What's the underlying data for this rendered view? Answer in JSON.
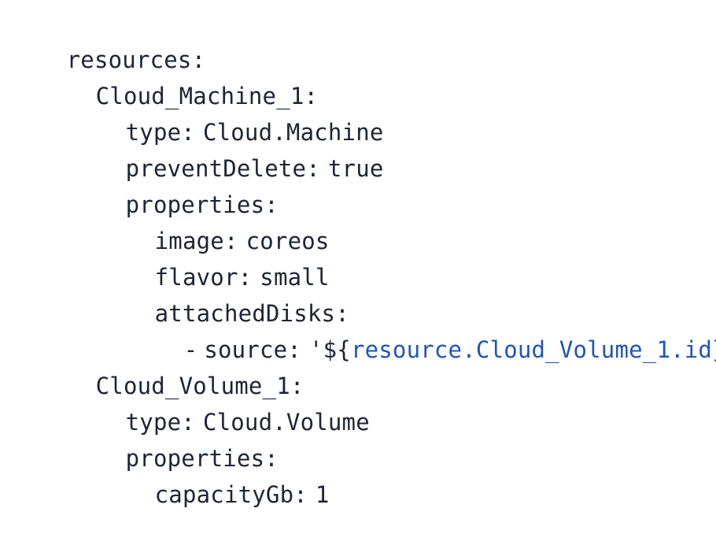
{
  "code": {
    "resources_key": "resources",
    "machine": {
      "name": "Cloud_Machine_1",
      "type_key": "type",
      "type_value": "Cloud.Machine",
      "prevent_key": "preventDelete",
      "prevent_value": "true",
      "properties_key": "properties",
      "image_key": "image",
      "image_value": "coreos",
      "flavor_key": "flavor",
      "flavor_value": "small",
      "disks_key": "attachedDisks",
      "source_dash": "-",
      "source_key": "source",
      "source_open": "'${",
      "source_ref": "resource.Cloud_Volume_1.id",
      "source_close": "}'"
    },
    "volume": {
      "name": "Cloud_Volume_1",
      "type_key": "type",
      "type_value": "Cloud.Volume",
      "properties_key": "properties",
      "capacity_key": "capacityGb",
      "capacity_value": "1"
    }
  },
  "colors": {
    "text": "#1d2433",
    "reference": "#1f55b8",
    "background": "#ffffff"
  }
}
